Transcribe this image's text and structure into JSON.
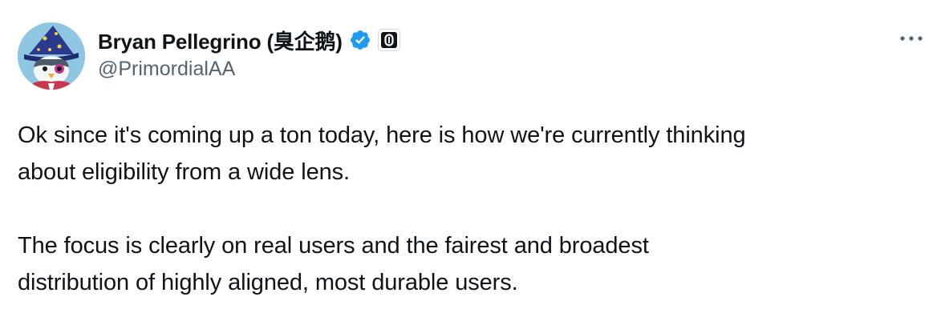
{
  "author": {
    "display_name": "Bryan Pellegrino (臭企鹅)",
    "handle": "@PrimordialAA",
    "verified": true,
    "affiliate_badge_glyph": "0",
    "verified_color": "#1d9bf0"
  },
  "menu": {
    "more_icon": "more-horizontal-icon"
  },
  "tweet": {
    "paragraphs": [
      {
        "line1": "Ok since it's coming up a ton today, here is how we're currently thinking",
        "line2": "about eligibility from a wide lens."
      },
      {
        "line1": "The focus is clearly on real users and the fairest and broadest",
        "line2": "distribution of highly aligned, most durable users."
      }
    ]
  },
  "colors": {
    "text": "#0f1419",
    "secondary": "#536471",
    "background": "#ffffff"
  }
}
